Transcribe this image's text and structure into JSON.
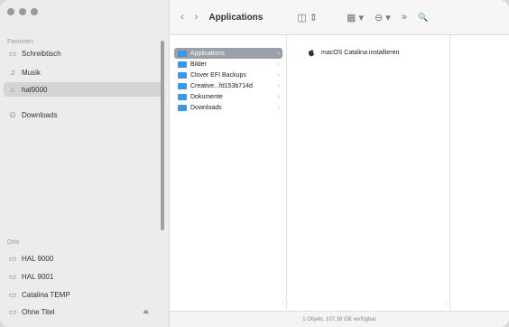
{
  "sidebar": {
    "favorites_header": "Favoriten",
    "favorites": [
      {
        "label": "Schreibtisch",
        "icon": "desktop-icon"
      },
      {
        "label": "Musik",
        "icon": "music-icon"
      },
      {
        "label": "hal9000",
        "icon": "home-icon"
      },
      {
        "label": "Downloads",
        "icon": "downloads-icon"
      }
    ],
    "locations_header": "Orte",
    "locations": [
      {
        "label": "HAL 9000",
        "icon": "drive-icon"
      },
      {
        "label": "HAL 9001",
        "icon": "drive-icon"
      },
      {
        "label": "Catalina TEMP",
        "icon": "drive-icon"
      },
      {
        "label": "Ohne Titel",
        "icon": "drive-icon",
        "eject": "⏏"
      }
    ]
  },
  "toolbar": {
    "back": "‹",
    "forward": "›",
    "title": "Applications",
    "view_columns": "◫ ⇕",
    "group": "▦ ▾",
    "action": "⊖ ▾",
    "more": "»",
    "search": "🔍"
  },
  "columns": {
    "col1": [
      {
        "label": "Applications",
        "selected": true
      },
      {
        "label": "Bilder"
      },
      {
        "label": "Clover EFI Backups"
      },
      {
        "label": "Creative...fd153b714d"
      },
      {
        "label": "Dokumente"
      },
      {
        "label": "Downloads"
      }
    ],
    "col2": [
      {
        "label": "macOS Catalina installieren",
        "icon": "apple-icon"
      }
    ]
  },
  "status": "1 Objekt, 107,38 GB verfügbar"
}
